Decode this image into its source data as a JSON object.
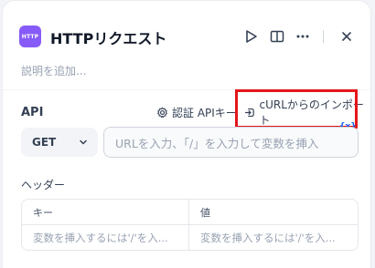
{
  "node": {
    "icon_text": "HTTP",
    "title": "HTTPリクエスト",
    "description_placeholder": "説明を追加...",
    "icon_color": "#875bf7"
  },
  "header_actions": {
    "run_icon": "play-icon",
    "docs_icon": "book-open-icon",
    "more_icon": "more-horizontal-icon",
    "close_icon": "close-icon"
  },
  "api": {
    "label": "API",
    "auth_label": "認証 APIキー",
    "curl_label": "cURLからのインポート",
    "var_badge": "{x}",
    "method": "GET",
    "url_placeholder": "URLを入力、「/」を入力して変数を挿入"
  },
  "headers": {
    "label": "ヘッダー",
    "columns": [
      "キー",
      "値"
    ],
    "row_placeholders": [
      "変数を挿入するには'/'を入...",
      "変数を挿入するには'/'を入..."
    ]
  },
  "highlight_color": "#e4161a"
}
